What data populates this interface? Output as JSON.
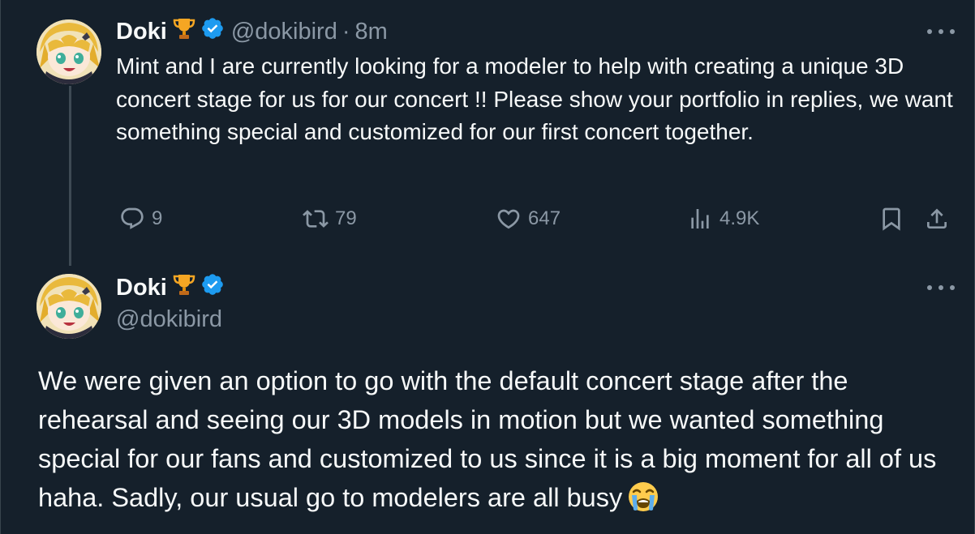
{
  "colors": {
    "background": "#15202b",
    "text": "#f7f9f9",
    "secondary": "#8b98a5",
    "verified": "#1d9bf0",
    "thread_line": "#3e4a54"
  },
  "tweet1": {
    "name": "Doki",
    "handle": "@dokibird",
    "separator": "·",
    "time": "8m",
    "text": "Mint and I are currently looking for a modeler to help with creating a unique 3D concert stage for us for our concert !! Please show your portfolio in replies, we want something special and customized for our first concert together.",
    "actions": {
      "replies": "9",
      "reposts": "79",
      "likes": "647",
      "views": "4.9K"
    },
    "icons": [
      "trophy-icon",
      "verified-icon",
      "more-icon",
      "reply-icon",
      "repost-icon",
      "like-icon",
      "views-icon",
      "bookmark-icon",
      "share-icon"
    ]
  },
  "tweet2": {
    "name": "Doki",
    "handle": "@dokibird",
    "text": "We were given an option to go with the default concert stage after the rehearsal and seeing our 3D models in motion but we wanted something special for our fans and customized to us since it is a big moment for all of us haha. Sadly, our usual go to modelers are all busy",
    "emoji": "loudly-crying-face"
  }
}
